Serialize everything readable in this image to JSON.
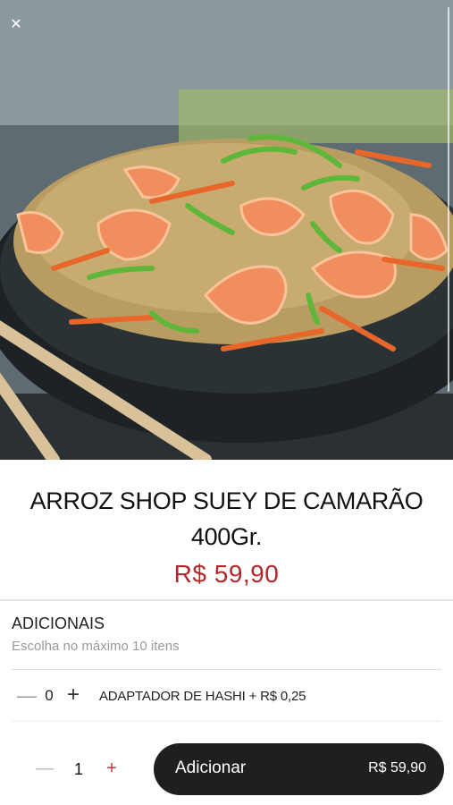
{
  "product": {
    "image_alt": "Arroz shop suey com camarão",
    "close_icon": "close-icon",
    "title": "ARROZ SHOP SUEY DE CAMARÃO 400Gr.",
    "price": "R$ 59,90"
  },
  "addons": {
    "title": "ADICIONAIS",
    "subtitle": "Escolha no máximo 10 itens",
    "items": [
      {
        "qty": "0",
        "label": "ADAPTADOR DE HASHI + R$ 0,25"
      }
    ]
  },
  "footer": {
    "qty": "1",
    "add_label": "Adicionar",
    "add_price": "R$ 59,90"
  },
  "colors": {
    "price": "#b3262a",
    "button_bg": "#1f1f1f",
    "plus_accent": "#c8343a"
  }
}
